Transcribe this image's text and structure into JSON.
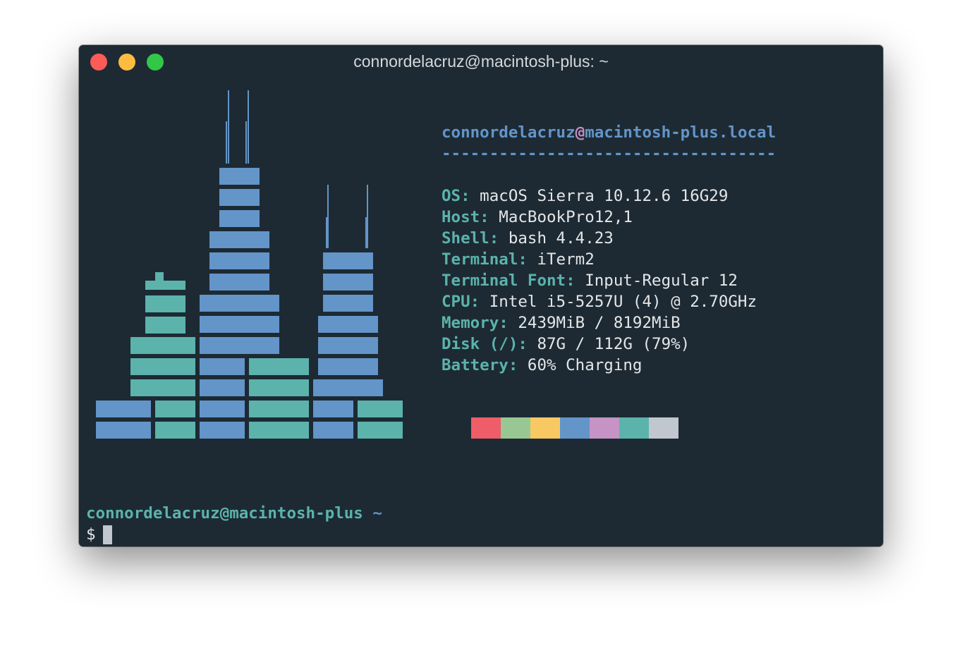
{
  "window": {
    "title": "connordelacruz@macintosh-plus: ~"
  },
  "info": {
    "user": "connordelacruz",
    "at": "@",
    "host": "macintosh-plus.local",
    "separator": "-----------------------------------",
    "rows": [
      {
        "key": "OS:",
        "value": " macOS Sierra 10.12.6 16G29"
      },
      {
        "key": "Host:",
        "value": " MacBookPro12,1"
      },
      {
        "key": "Shell:",
        "value": " bash 4.4.23"
      },
      {
        "key": "Terminal:",
        "value": " iTerm2"
      },
      {
        "key": "Terminal Font:",
        "value": " Input-Regular 12"
      },
      {
        "key": "CPU:",
        "value": " Intel i5-5257U (4) @ 2.70GHz"
      },
      {
        "key": "Memory:",
        "value": " 2439MiB / 8192MiB"
      },
      {
        "key": "Disk (/):",
        "value": " 87G / 112G (79%)"
      },
      {
        "key": "Battery:",
        "value": " 60% Charging"
      }
    ]
  },
  "palette": [
    "#ee5d68",
    "#98c793",
    "#f8c963",
    "#6395c9",
    "#c594c5",
    "#5bb3ac",
    "#c1c7cf"
  ],
  "art_colors": {
    "blue": "#6395c9",
    "teal": "#5bb3ac"
  },
  "prompt": {
    "user_host": "connordelacruz@macintosh-plus",
    "tilde": "~",
    "dollar": "$"
  }
}
